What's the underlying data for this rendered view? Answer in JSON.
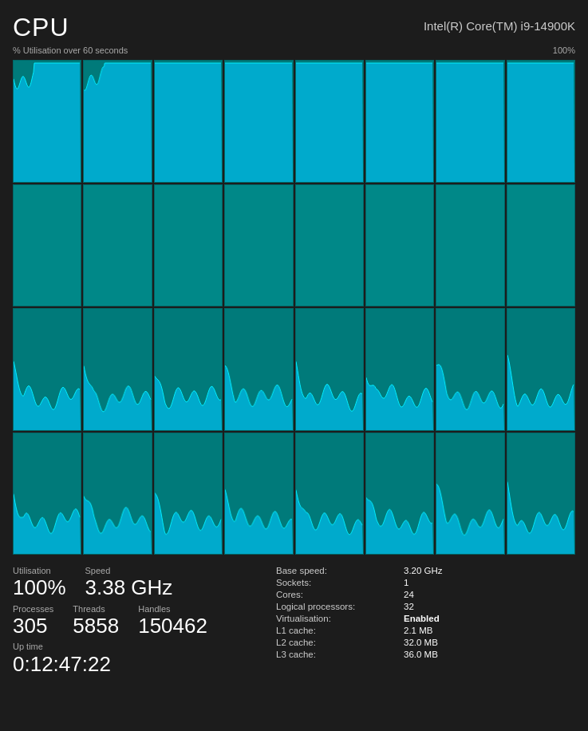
{
  "header": {
    "title": "CPU",
    "model": "Intel(R) Core(TM) i9-14900K"
  },
  "subtitle": {
    "left": "% Utilisation over 60 seconds",
    "right": "100%"
  },
  "graphs": {
    "rows": 4,
    "cols": 8,
    "total": 32,
    "active_rows": [
      2,
      3
    ],
    "color_bg": "#009999",
    "color_wave": "#00cccc"
  },
  "stats": {
    "utilisation_label": "Utilisation",
    "utilisation_value": "100%",
    "speed_label": "Speed",
    "speed_value": "3.38 GHz",
    "processes_label": "Processes",
    "processes_value": "305",
    "threads_label": "Threads",
    "threads_value": "5858",
    "handles_label": "Handles",
    "handles_value": "150462",
    "uptime_label": "Up time",
    "uptime_value": "0:12:47:22"
  },
  "info": {
    "base_speed_label": "Base speed:",
    "base_speed_value": "3.20 GHz",
    "sockets_label": "Sockets:",
    "sockets_value": "1",
    "cores_label": "Cores:",
    "cores_value": "24",
    "logical_label": "Logical processors:",
    "logical_value": "32",
    "virtualisation_label": "Virtualisation:",
    "virtualisation_value": "Enabled",
    "l1_label": "L1 cache:",
    "l1_value": "2.1 MB",
    "l2_label": "L2 cache:",
    "l2_value": "32.0 MB",
    "l3_label": "L3 cache:",
    "l3_value": "36.0 MB"
  }
}
